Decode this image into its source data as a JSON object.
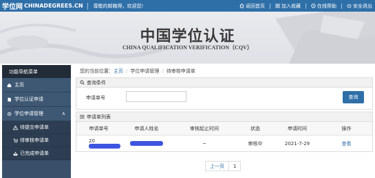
{
  "topbar": {
    "logo_cn": "学位网",
    "logo_en": "CHINADEGREES.CN",
    "greeting": "尊敬的邮箱得，欢迎您!",
    "links": [
      {
        "label": "返回首页",
        "icon": "home-icon"
      },
      {
        "label": "加入收藏",
        "icon": "bookmark-icon"
      },
      {
        "label": "在线帮助",
        "icon": "help-icon"
      },
      {
        "label": "安全退出",
        "icon": "logout-icon"
      }
    ]
  },
  "banner": {
    "title": "中国学位认证",
    "subtitle": "CHINA QUALIFICATION VERIFICATION（CQV）"
  },
  "sidebar": {
    "header": "功能导航菜单",
    "items": [
      {
        "label": "主页",
        "icon": "home-icon"
      },
      {
        "label": "学位认证申请",
        "icon": "file-icon"
      },
      {
        "label": "学位申请管理",
        "icon": "gear-icon",
        "expand": "∧"
      }
    ],
    "subitems": [
      {
        "label": "待提交申请单",
        "icon": "warning-icon"
      },
      {
        "label": "待审核申请单",
        "icon": "cart-icon"
      },
      {
        "label": "已完成申请单",
        "icon": "inbox-icon"
      }
    ]
  },
  "breadcrumb": {
    "prefix": "您的当前位置",
    "home": "主页",
    "level1": "学位申请管理",
    "level2": "待审核申请单"
  },
  "query": {
    "header": "查询条件",
    "field_label": "申请单号",
    "field_value": "",
    "button": "查询"
  },
  "list": {
    "header": "申请单列表",
    "columns": [
      "申请单号",
      "申请人姓名",
      "审核起止时间",
      "状态",
      "申请时间",
      "操作"
    ],
    "rows": [
      {
        "id_prefix": "20",
        "dates": "~",
        "status": "审核中",
        "date": "2021-7-29",
        "action": "查看"
      }
    ]
  },
  "pager": {
    "prev": "上一页",
    "current": "1"
  },
  "colors": {
    "primary": "#2f6fa8",
    "sidebar": "#3a506a",
    "sidebar_dark": "#222c38",
    "redaction": "#3e55e0"
  }
}
